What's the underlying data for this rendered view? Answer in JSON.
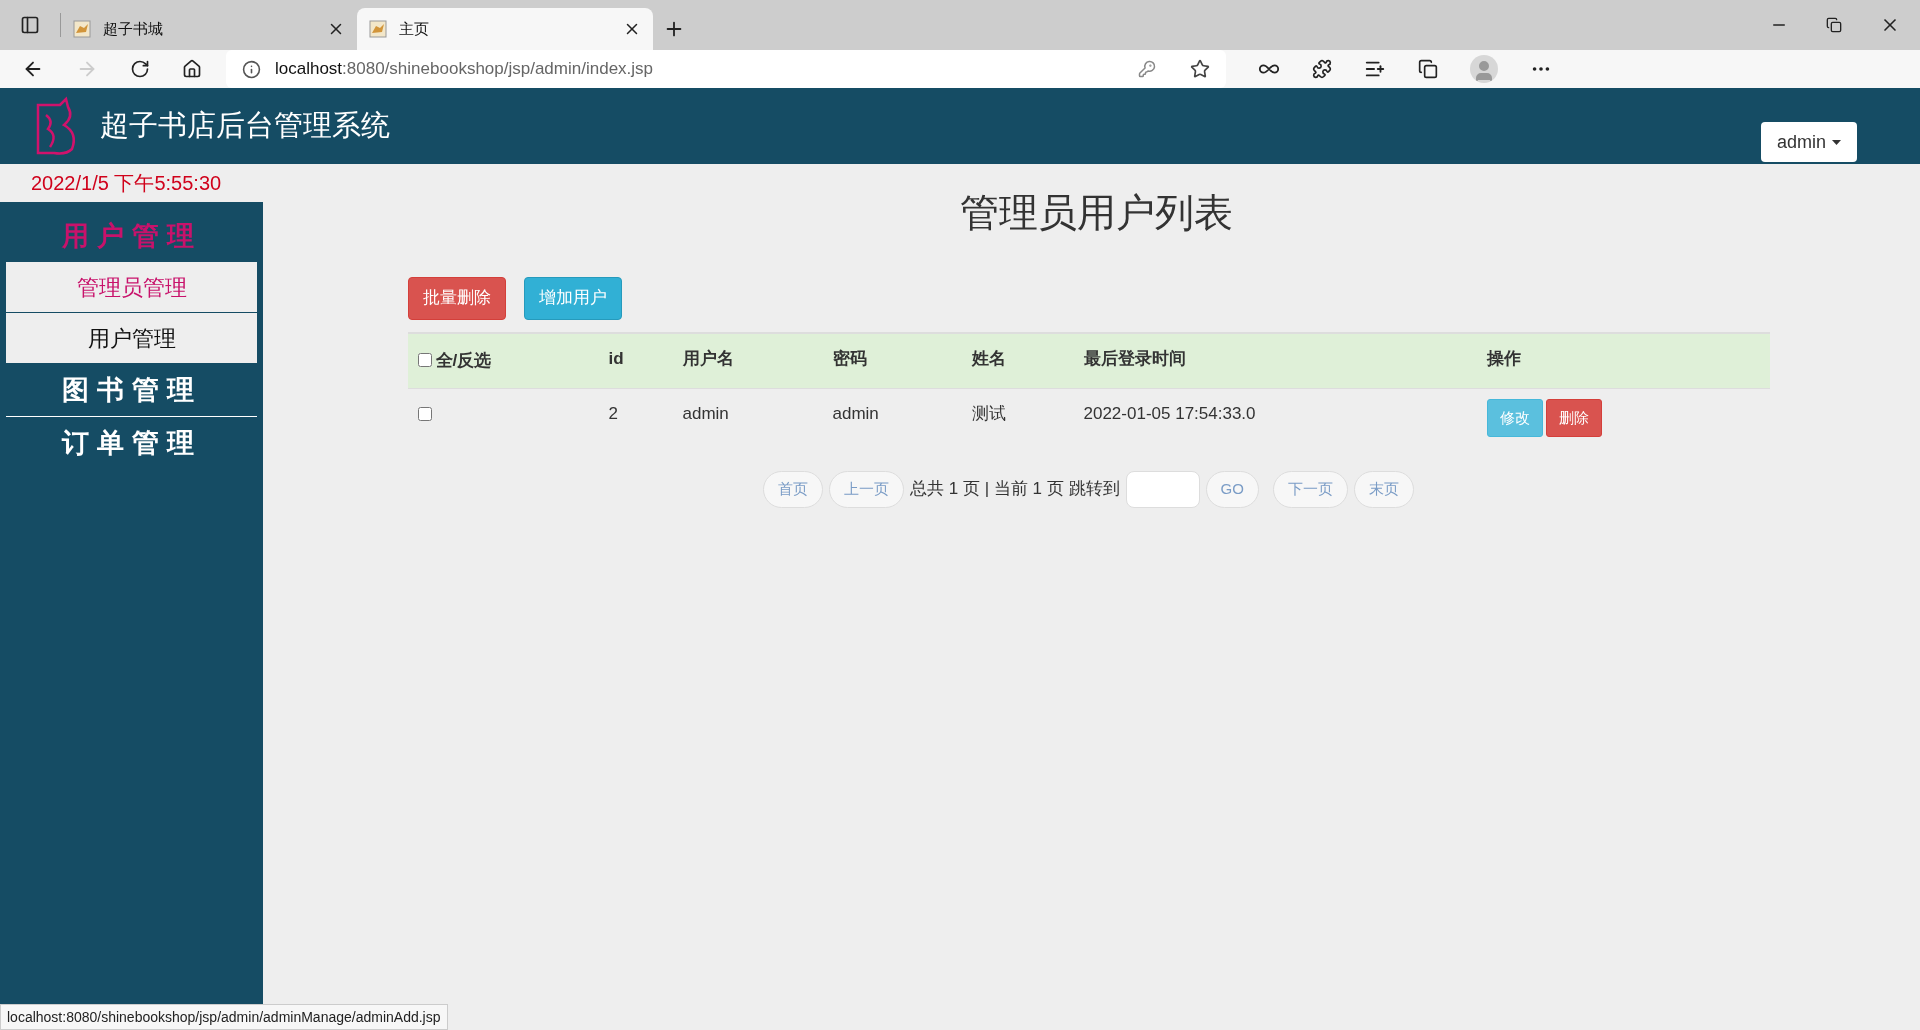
{
  "browser": {
    "tabs": [
      {
        "title": "超子书城",
        "selected": false
      },
      {
        "title": "主页",
        "selected": true
      }
    ],
    "address": {
      "host": "localhost",
      "path": ":8080/shinebookshop/jsp/admin/index.jsp"
    },
    "status_url": "localhost:8080/shinebookshop/jsp/admin/adminManage/adminAdd.jsp"
  },
  "header": {
    "title": "超子书店后台管理系统",
    "user_menu": "admin"
  },
  "datetime": "2022/1/5 下午5:55:30",
  "sidebar": {
    "sections": [
      {
        "title": "用户管理",
        "selected": true,
        "items": [
          {
            "label": "管理员管理",
            "selected": true
          },
          {
            "label": "用户管理",
            "selected": false
          }
        ]
      },
      {
        "title": "图书管理",
        "selected": false
      },
      {
        "title": "订单管理",
        "selected": false
      }
    ]
  },
  "page_title": "管理员用户列表",
  "actions": [
    {
      "label": "批量删除",
      "kind": "danger"
    },
    {
      "label": "增加用户",
      "kind": "info"
    }
  ],
  "table": {
    "select_all": {
      "label": "全/反选",
      "checked": false
    },
    "columns": [
      "id",
      "用户名",
      "密码",
      "姓名",
      "最后登录时间",
      "操作"
    ],
    "rows": [
      {
        "checked": false,
        "cells": [
          "2",
          "admin",
          "admin",
          "测试",
          "2022-01-05 17:54:33.0"
        ],
        "actions": [
          {
            "label": "修改",
            "kind": "info"
          },
          {
            "label": "删除",
            "kind": "danger"
          }
        ]
      }
    ]
  },
  "pagination": {
    "first": "首页",
    "prev": "上一页",
    "summary": "总共 1 页 | 当前 1 页 跳转到",
    "go": "GO",
    "next": "下一页",
    "last": "末页"
  }
}
